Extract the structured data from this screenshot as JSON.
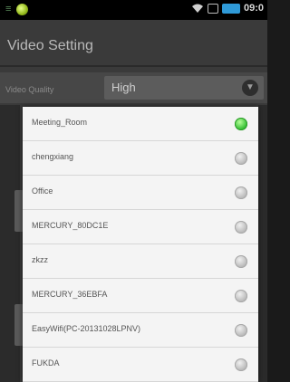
{
  "status_bar": {
    "time": "09:0",
    "icons": [
      "menu-glyph",
      "app-ball-icon",
      "wifi-icon",
      "sim-icon",
      "battery-icon"
    ]
  },
  "settings": {
    "title": "Video Setting",
    "quality_label": "Video Quality",
    "quality_value": "High"
  },
  "wifi_list": {
    "items": [
      {
        "label": "Meeting_Room",
        "selected": true
      },
      {
        "label": "chengxiang",
        "selected": false
      },
      {
        "label": "Office",
        "selected": false
      },
      {
        "label": "MERCURY_80DC1E",
        "selected": false
      },
      {
        "label": "zkzz",
        "selected": false
      },
      {
        "label": "MERCURY_36EBFA",
        "selected": false
      },
      {
        "label": "EasyWifi(PC-20131028LPNV)",
        "selected": false
      },
      {
        "label": "FUKDA",
        "selected": false
      }
    ]
  },
  "colors": {
    "selected_radio": "#3cc23a",
    "unselected_radio": "#b5b5b5",
    "battery": "#2f9ad8"
  }
}
